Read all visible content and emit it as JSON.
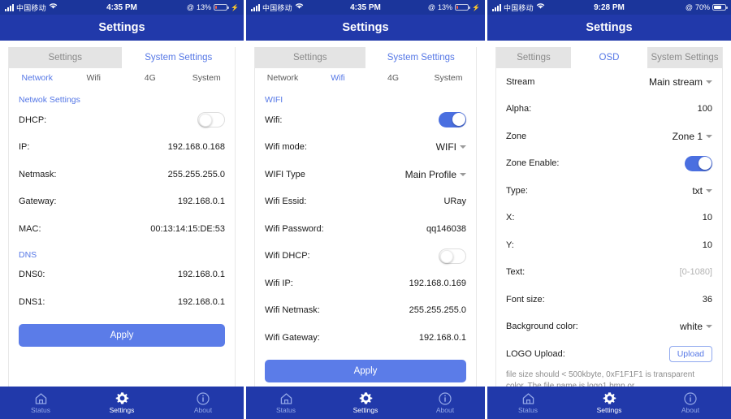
{
  "screens": [
    {
      "status": {
        "carrier": "中国移动",
        "wifi_icon": "wifi-icon",
        "time": "4:35 PM",
        "location_icon": "location-icon",
        "battery_text": "13%",
        "battery_level": 13,
        "battery_color": "#f0624d",
        "charging": true,
        "charge_icon": "lightning-bolt-icon"
      },
      "nav_title": "Settings",
      "main_tabs": [
        {
          "label": "Settings",
          "active": false
        },
        {
          "label": "System Settings",
          "active": true
        }
      ],
      "sub_tabs": [
        {
          "label": "Network",
          "active": true
        },
        {
          "label": "Wifi",
          "active": false
        },
        {
          "label": "4G",
          "active": false
        },
        {
          "label": "System",
          "active": false
        }
      ],
      "sections": [
        {
          "label": "Netwok Settings",
          "rows": [
            {
              "label": "DHCP:",
              "type": "toggle",
              "on": false
            },
            {
              "label": "IP:",
              "type": "text",
              "value": "192.168.0.168"
            },
            {
              "label": "Netmask:",
              "type": "text",
              "value": "255.255.255.0"
            },
            {
              "label": "Gateway:",
              "type": "text",
              "value": "192.168.0.1"
            },
            {
              "label": "MAC:",
              "type": "text",
              "value": "00:13:14:15:DE:53"
            }
          ]
        },
        {
          "label": "DNS",
          "rows": [
            {
              "label": "DNS0:",
              "type": "text",
              "value": "192.168.0.1"
            },
            {
              "label": "DNS1:",
              "type": "text",
              "value": "192.168.0.1"
            }
          ]
        }
      ],
      "apply_label": "Apply"
    },
    {
      "status": {
        "carrier": "中国移动",
        "wifi_icon": "wifi-icon",
        "time": "4:35 PM",
        "location_icon": "location-icon",
        "battery_text": "13%",
        "battery_level": 13,
        "battery_color": "#f0624d",
        "charging": true,
        "charge_icon": "lightning-bolt-icon"
      },
      "nav_title": "Settings",
      "main_tabs": [
        {
          "label": "Settings",
          "active": false
        },
        {
          "label": "System Settings",
          "active": true
        }
      ],
      "sub_tabs": [
        {
          "label": "Network",
          "active": false
        },
        {
          "label": "Wifi",
          "active": true
        },
        {
          "label": "4G",
          "active": false
        },
        {
          "label": "System",
          "active": false
        }
      ],
      "sections": [
        {
          "label": "WIFI",
          "rows": [
            {
              "label": "Wifi:",
              "type": "toggle",
              "on": true
            },
            {
              "label": "Wifi mode:",
              "type": "select",
              "value": "WIFI"
            },
            {
              "label": "WIFI Type",
              "type": "select",
              "value": "Main Profile"
            },
            {
              "label": "Wifi Essid:",
              "type": "text",
              "value": "URay"
            },
            {
              "label": "Wifi Password:",
              "type": "text",
              "value": "qq146038"
            },
            {
              "label": "Wifi DHCP:",
              "type": "toggle",
              "on": false
            },
            {
              "label": "Wifi IP:",
              "type": "text",
              "value": "192.168.0.169"
            },
            {
              "label": "Wifi Netmask:",
              "type": "text",
              "value": "255.255.255.0"
            },
            {
              "label": "Wifi Gateway:",
              "type": "text",
              "value": "192.168.0.1"
            }
          ]
        }
      ],
      "apply_label": "Apply"
    },
    {
      "status": {
        "carrier": "中国移动",
        "wifi_icon": "wifi-icon",
        "time": "9:28 PM",
        "location_icon": "location-icon",
        "battery_text": "70%",
        "battery_level": 70,
        "battery_color": "#ffffff",
        "charging": false,
        "charge_icon": ""
      },
      "nav_title": "Settings",
      "main_tabs": [
        {
          "label": "Settings",
          "active": false
        },
        {
          "label": "OSD",
          "active": true
        },
        {
          "label": "System Settings",
          "active": false
        }
      ],
      "sub_tabs": [],
      "sections": [
        {
          "label": "",
          "rows": [
            {
              "label": "Stream",
              "type": "select",
              "value": "Main stream"
            },
            {
              "label": "Alpha:",
              "type": "text",
              "value": "100"
            },
            {
              "label": "Zone",
              "type": "select",
              "value": "Zone 1"
            },
            {
              "label": "Zone Enable:",
              "type": "toggle",
              "on": true
            },
            {
              "label": "Type:",
              "type": "select",
              "value": "txt"
            },
            {
              "label": "X:",
              "type": "text",
              "value": "10"
            },
            {
              "label": "Y:",
              "type": "text",
              "value": "10"
            },
            {
              "label": "Text:",
              "type": "placeholder",
              "value": "[0-1080]"
            },
            {
              "label": "Font size:",
              "type": "text",
              "value": "36"
            },
            {
              "label": "Background color:",
              "type": "select",
              "value": "white"
            },
            {
              "label": "LOGO Upload:",
              "type": "button",
              "value": "Upload"
            }
          ]
        }
      ],
      "note": "file size should < 500kbyte, 0xF1F1F1 is transparent color. The file name is logo1.bmp or",
      "apply_label": ""
    }
  ],
  "tabbar": {
    "items": [
      {
        "label": "Status",
        "icon": "home-icon",
        "active": false
      },
      {
        "label": "Settings",
        "icon": "gear-icon",
        "active": true
      },
      {
        "label": "About",
        "icon": "info-icon",
        "active": false
      }
    ]
  },
  "theme": {
    "navbar_blue": "#2139aa",
    "statusbar_blue": "#1b359b",
    "accent_blue": "#5577e6",
    "toggle_on": "#4a6fe0",
    "apply_blue": "#5b7ce8"
  }
}
